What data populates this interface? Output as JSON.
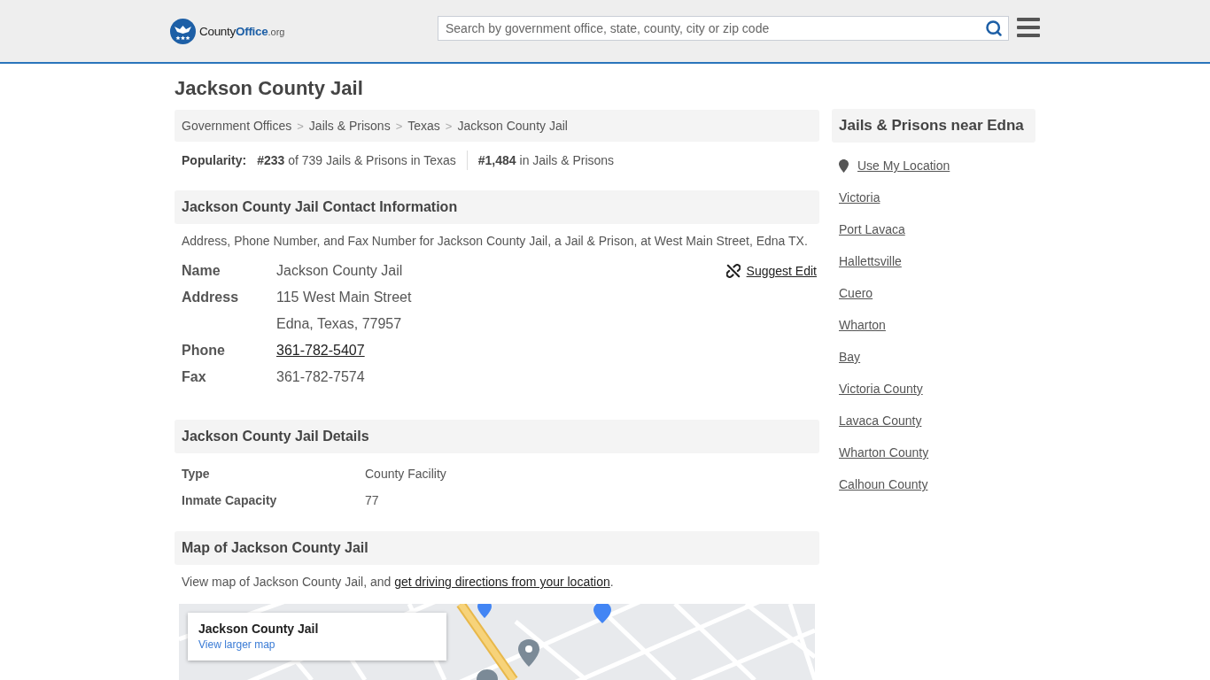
{
  "header": {
    "logo": {
      "text": "County",
      "accent": "Office",
      "suffix": ".org"
    },
    "search": {
      "placeholder": "Search by government office, state, county, city or zip code"
    }
  },
  "page_title": "Jackson County Jail",
  "breadcrumb": {
    "separator": ">",
    "items": [
      "Government Offices",
      "Jails & Prisons",
      "Texas",
      "Jackson County Jail"
    ]
  },
  "popularity": {
    "label": "Popularity:",
    "ranks": [
      "**#233** of 739 Jails & Prisons in Texas",
      "**#1,484** in Jails & Prisons"
    ]
  },
  "contact": {
    "title": "Jackson County Jail Contact Information",
    "description": "Address, Phone Number, and Fax Number for Jackson County Jail, a Jail & Prison, at West Main Street, Edna TX.",
    "suggest_edit": "Suggest Edit",
    "rows": [
      {
        "label": "Name",
        "kind": "text",
        "values": [
          "Jackson County Jail"
        ]
      },
      {
        "label": "Address",
        "kind": "text",
        "values": [
          "115 West Main Street",
          "Edna, Texas, 77957"
        ]
      },
      {
        "label": "Phone",
        "kind": "link",
        "values": [
          "361-782-5407"
        ]
      },
      {
        "label": "Fax",
        "kind": "text",
        "values": [
          "361-782-7574"
        ]
      }
    ]
  },
  "details": {
    "title": "Jackson County Jail Details",
    "rows": [
      {
        "label": "Type",
        "value": "County Facility"
      },
      {
        "label": "Inmate Capacity",
        "value": "77"
      }
    ]
  },
  "map": {
    "title": "Map of Jackson County Jail",
    "description": "View map of Jackson County Jail, and ",
    "directions_link": "get driving directions from your location",
    "description_end": ".",
    "card": {
      "place": "Jackson County Jail",
      "link": "View larger map"
    }
  },
  "sidebar": {
    "title": "Jails & Prisons near Edna",
    "location_link": "Use My Location",
    "links": [
      "Victoria",
      "Port Lavaca",
      "Hallettsville",
      "Cuero",
      "Wharton",
      "Bay",
      "Victoria County",
      "Lavaca County",
      "Wharton County",
      "Calhoun County"
    ]
  }
}
